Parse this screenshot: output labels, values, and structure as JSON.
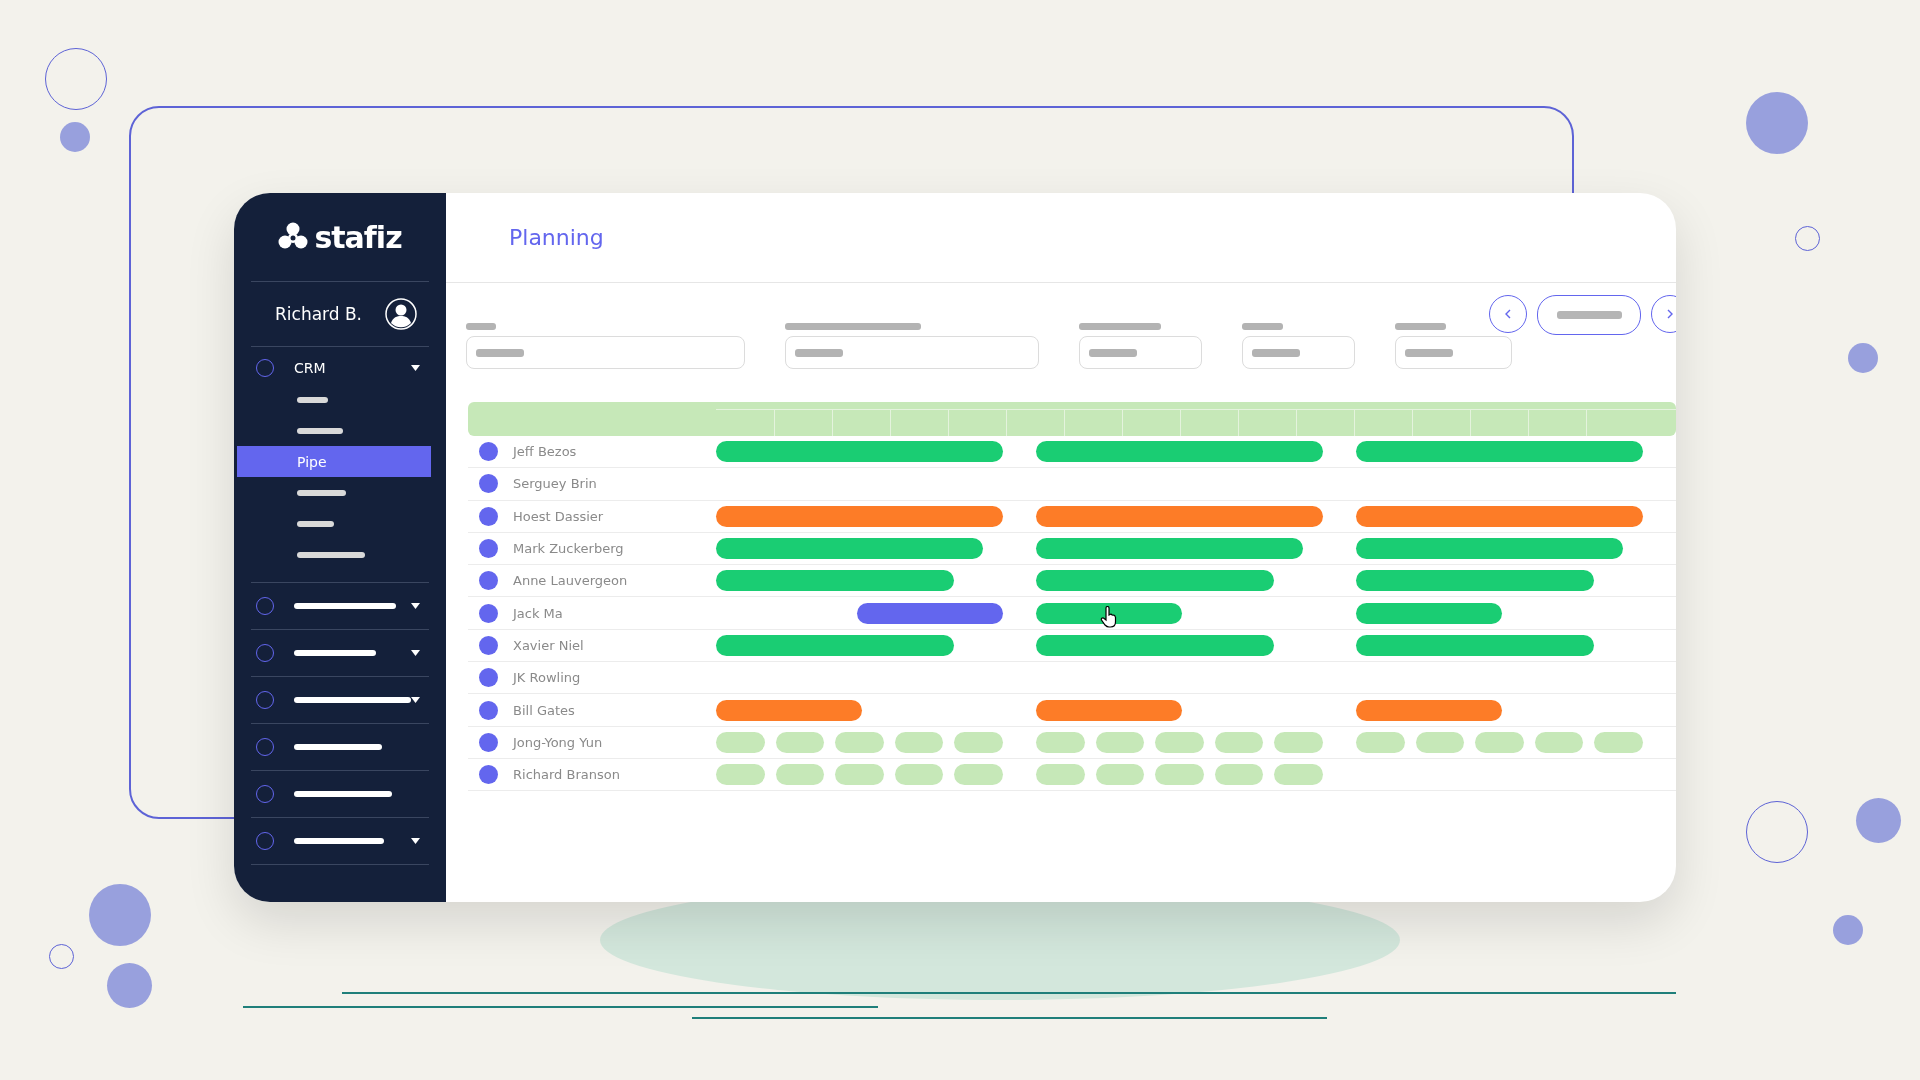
{
  "app": {
    "logo": "stafiz"
  },
  "user": {
    "name": "Richard B."
  },
  "nav": [
    {
      "kind": "text",
      "label": "CRM",
      "expandable": true,
      "children": [
        {
          "kind": "placeholder",
          "selected": false
        },
        {
          "kind": "placeholder",
          "selected": false
        },
        {
          "kind": "text",
          "label": "Pipe",
          "selected": true
        },
        {
          "kind": "placeholder",
          "selected": false
        },
        {
          "kind": "placeholder",
          "selected": false
        },
        {
          "kind": "placeholder",
          "selected": false
        }
      ]
    },
    {
      "kind": "placeholder",
      "expandable": true
    },
    {
      "kind": "placeholder",
      "expandable": true
    },
    {
      "kind": "placeholder",
      "expandable": true
    },
    {
      "kind": "placeholder",
      "expandable": false
    },
    {
      "kind": "placeholder",
      "expandable": false
    },
    {
      "kind": "placeholder",
      "expandable": true
    }
  ],
  "page": {
    "title": "Planning"
  },
  "rows": [
    {
      "name": "Jeff Bezos",
      "periods": [
        {
          "kind": "full",
          "color": "#1acd73"
        },
        {
          "kind": "full",
          "color": "#1acd73"
        },
        {
          "kind": "full",
          "color": "#1acd73"
        }
      ]
    },
    {
      "name": "Serguey Brin",
      "periods": [
        {
          "kind": "empty"
        },
        {
          "kind": "empty"
        },
        {
          "kind": "empty"
        }
      ]
    },
    {
      "name": "Hoest Dassier",
      "periods": [
        {
          "kind": "full",
          "color": "#fd7c27"
        },
        {
          "kind": "full",
          "color": "#fd7c27"
        },
        {
          "kind": "full",
          "color": "#fd7c27"
        }
      ]
    },
    {
      "name": "Mark Zuckerberg",
      "periods": [
        {
          "kind": "long",
          "color": "#1acd73"
        },
        {
          "kind": "long",
          "color": "#1acd73"
        },
        {
          "kind": "long",
          "color": "#1acd73"
        }
      ]
    },
    {
      "name": "Anne Lauvergeon",
      "periods": [
        {
          "kind": "medium",
          "color": "#1acd73"
        },
        {
          "kind": "medium",
          "color": "#1acd73"
        },
        {
          "kind": "medium",
          "color": "#1acd73"
        }
      ]
    },
    {
      "name": "Jack Ma",
      "periods": [
        {
          "kind": "short-end",
          "color": "#6366ee"
        },
        {
          "kind": "short",
          "color": "#1acd73"
        },
        {
          "kind": "short",
          "color": "#1acd73"
        }
      ]
    },
    {
      "name": "Xavier Niel",
      "periods": [
        {
          "kind": "medium",
          "color": "#1acd73"
        },
        {
          "kind": "medium",
          "color": "#1acd73"
        },
        {
          "kind": "medium",
          "color": "#1acd73"
        }
      ]
    },
    {
      "name": "JK Rowling",
      "periods": [
        {
          "kind": "empty"
        },
        {
          "kind": "empty"
        },
        {
          "kind": "empty"
        }
      ]
    },
    {
      "name": "Bill Gates",
      "periods": [
        {
          "kind": "short",
          "color": "#fd7c27"
        },
        {
          "kind": "short",
          "color": "#fd7c27"
        },
        {
          "kind": "short",
          "color": "#fd7c27"
        }
      ]
    },
    {
      "name": "Jong-Yong Yun",
      "periods": [
        {
          "kind": "slots",
          "color": "#c6e8b8"
        },
        {
          "kind": "slots",
          "color": "#c6e8b8"
        },
        {
          "kind": "slots",
          "color": "#c6e8b8"
        }
      ]
    },
    {
      "name": "Richard Branson",
      "periods": [
        {
          "kind": "slots",
          "color": "#c6e8b8"
        },
        {
          "kind": "slots",
          "color": "#c6e8b8"
        },
        {
          "kind": "empty"
        }
      ]
    }
  ]
}
